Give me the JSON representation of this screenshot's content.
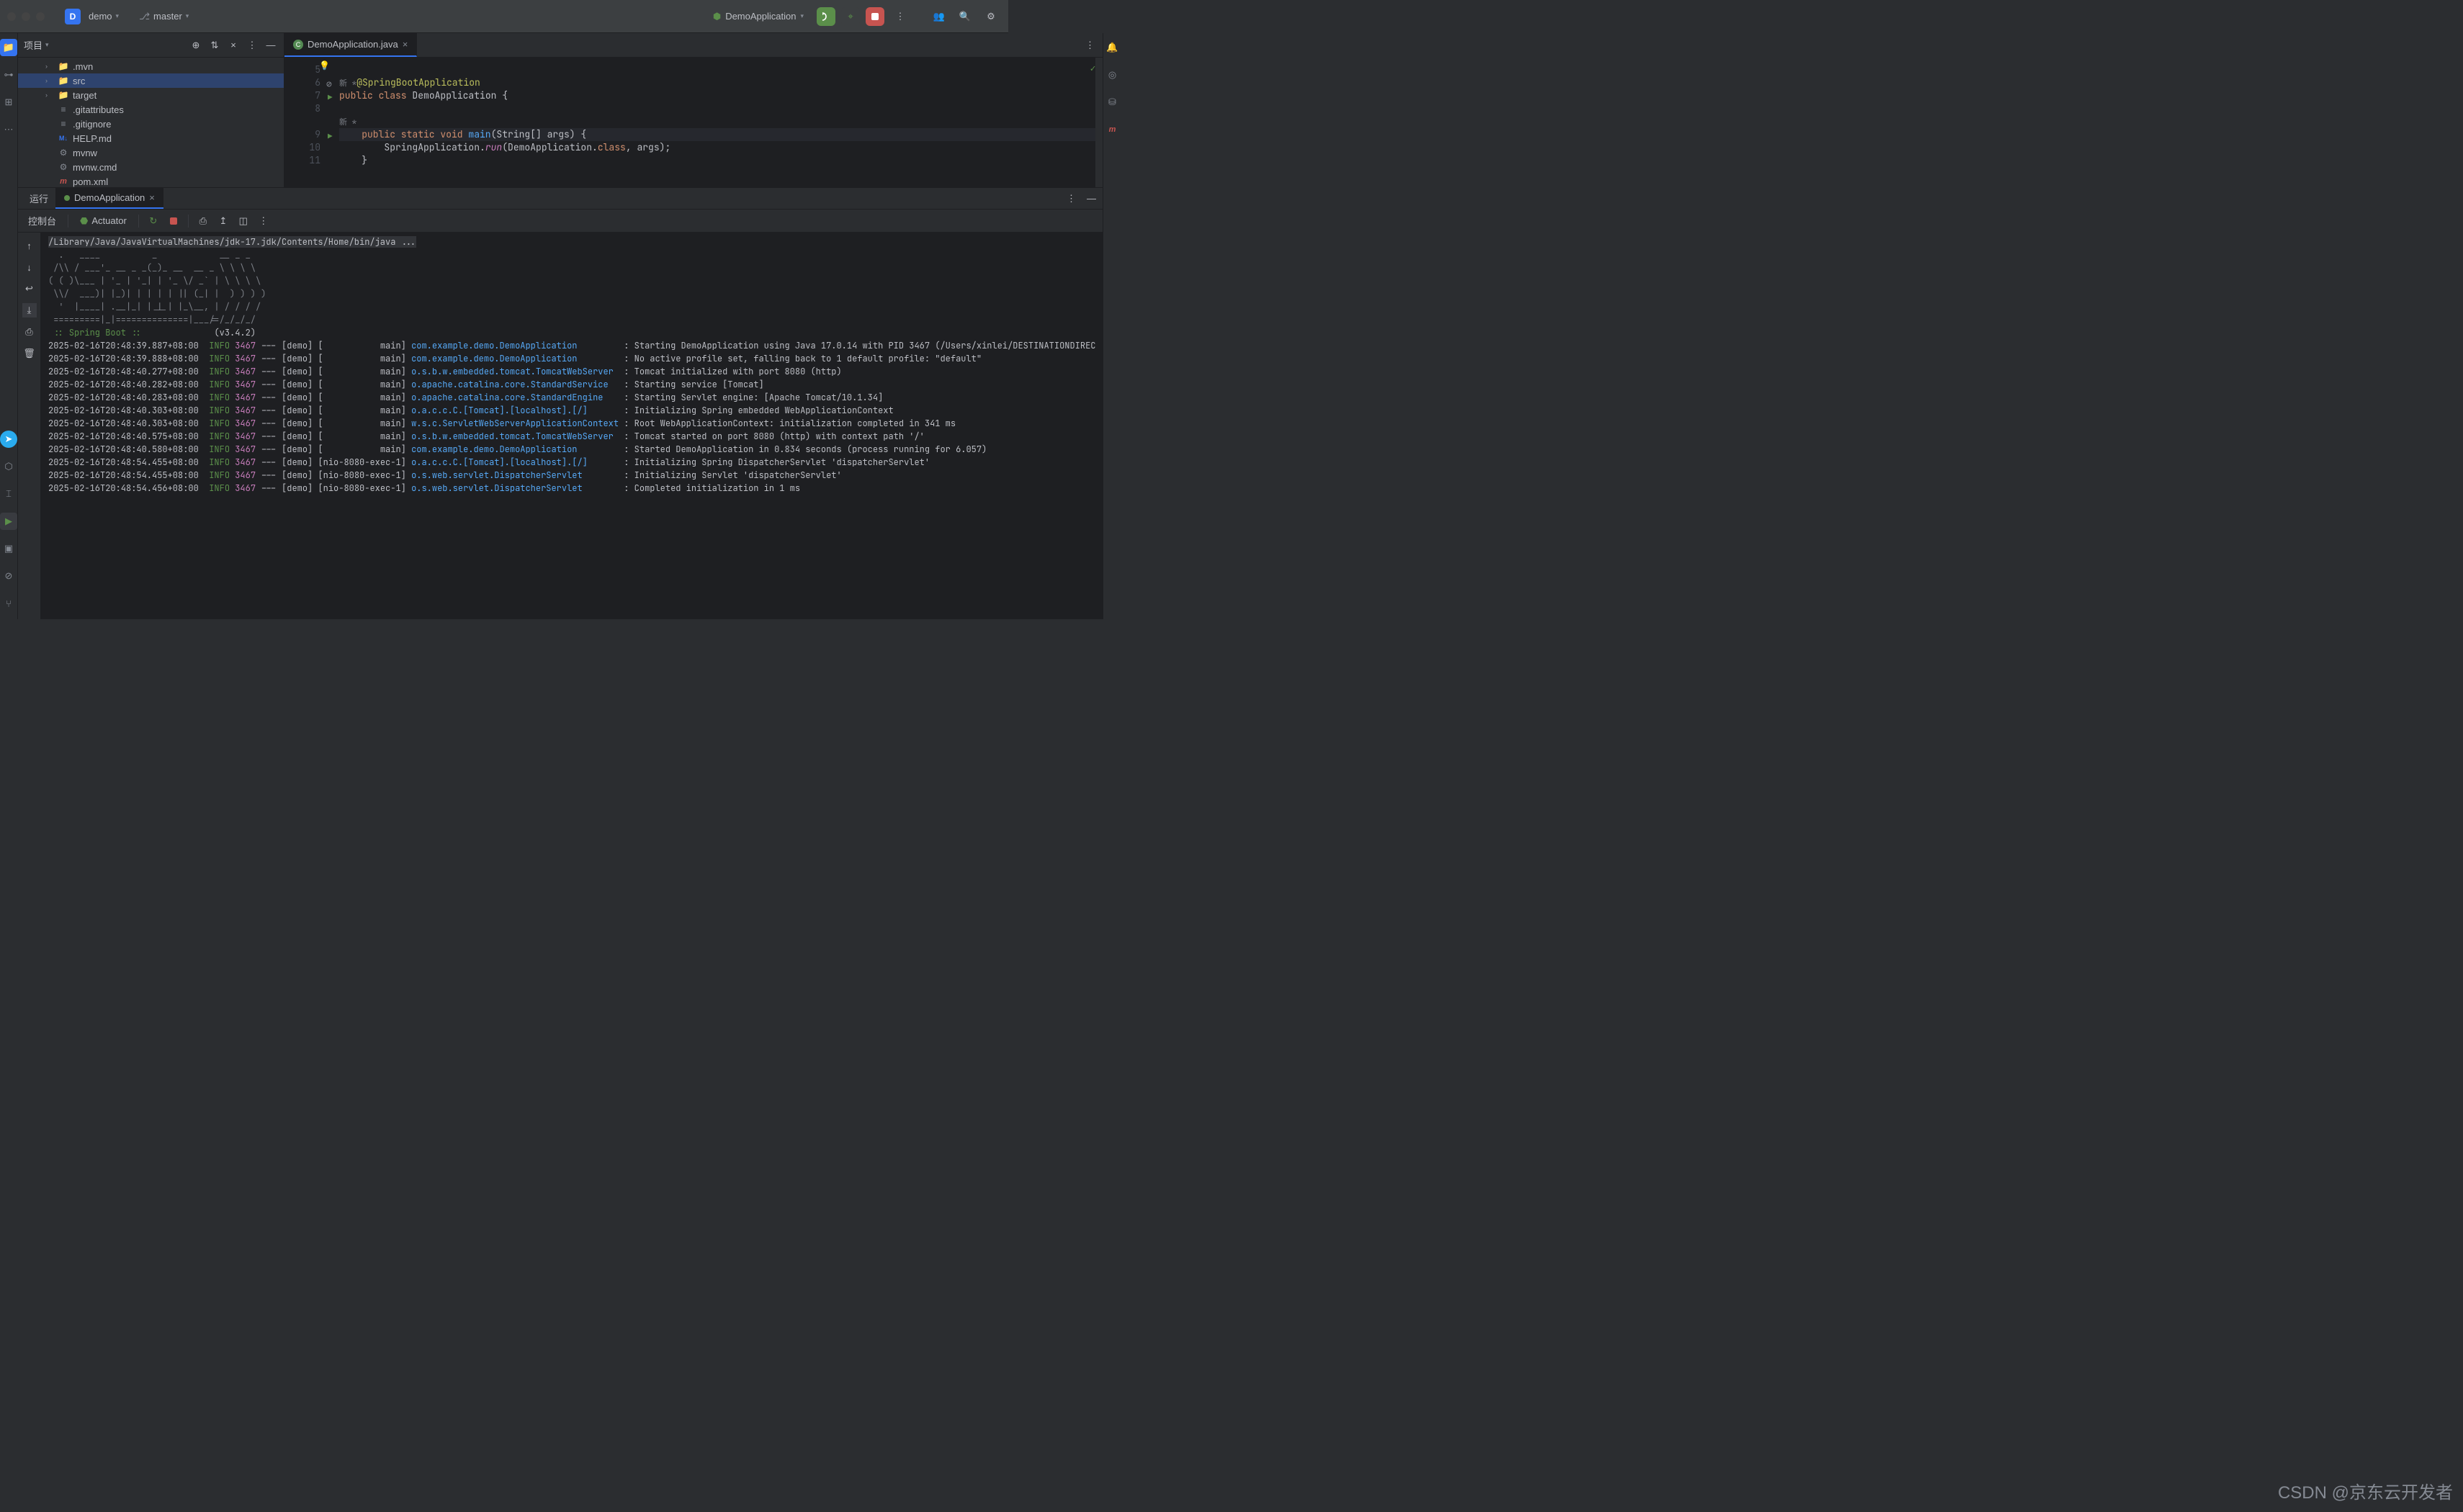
{
  "titlebar": {
    "project_letter": "D",
    "project_name": "demo",
    "branch_name": "master",
    "run_config": "DemoApplication"
  },
  "project": {
    "panel_title": "项目",
    "tree": [
      {
        "name": ".mvn",
        "type": "folder",
        "icon": "folder",
        "indent": 1,
        "expandable": true
      },
      {
        "name": "src",
        "type": "folder",
        "icon": "folder-src",
        "indent": 1,
        "expandable": true,
        "selected": true
      },
      {
        "name": "target",
        "type": "folder",
        "icon": "folder-tgt",
        "indent": 1,
        "expandable": true
      },
      {
        "name": ".gitattributes",
        "type": "file",
        "icon": "file-lines",
        "indent": 1
      },
      {
        "name": ".gitignore",
        "type": "file",
        "icon": "file-lines",
        "indent": 1
      },
      {
        "name": "HELP.md",
        "type": "file",
        "icon": "md",
        "indent": 1
      },
      {
        "name": "mvnw",
        "type": "file",
        "icon": "file-gear",
        "indent": 1
      },
      {
        "name": "mvnw.cmd",
        "type": "file",
        "icon": "file-gear",
        "indent": 1
      },
      {
        "name": "pom.xml",
        "type": "file",
        "icon": "m",
        "indent": 1
      }
    ]
  },
  "editor": {
    "tab_name": "DemoApplication.java",
    "lines": [
      {
        "num": "5",
        "inlay": ""
      },
      {
        "num": "6",
        "inlay": "新 *",
        "annotation": "@SpringBootApplication",
        "gutter": "no-inspect"
      },
      {
        "num": "7",
        "code_parts": [
          "public ",
          "class ",
          "DemoApplication {"
        ],
        "gutter": "run"
      },
      {
        "num": "8"
      },
      {
        "num": "",
        "inlay": "新 *",
        "bulb": true
      },
      {
        "num": "9",
        "gutter": "run",
        "hl": true,
        "code_main": true
      },
      {
        "num": "10",
        "code_spring": true
      },
      {
        "num": "11",
        "brace": "    }"
      }
    ],
    "code9": {
      "pre": "    public static void ",
      "main": "main",
      "args": "(String[] args)",
      "brace": " {"
    },
    "code10": {
      "indent": "        ",
      "app": "SpringApplication.",
      "run": "run",
      "open": "(DemoApplication.",
      "cls": "class",
      "rest": ", args);"
    }
  },
  "run": {
    "run_label": "运行",
    "config_name": "DemoApplication",
    "console_tab": "控制台",
    "actuator_tab": "Actuator",
    "cmd_line": "/Library/Java/JavaVirtualMachines/jdk-17.jdk/Contents/Home/bin/java ...",
    "banner": [
      "  .   ____          _            __ _ _",
      " /\\\\ / ___'_ __ _ _(_)_ __  __ _ \\ \\ \\ \\",
      "( ( )\\___ | '_ | '_| | '_ \\/ _` | \\ \\ \\ \\",
      " \\\\/  ___)| |_)| | | | | || (_| |  ) ) ) )",
      "  '  |____| .__|_| |_|_| |_\\__, | / / / /",
      " =========|_|==============|___/=/_/_/_/"
    ],
    "boot_label": " :: Spring Boot :: ",
    "boot_version": "(v3.4.2)",
    "logs": [
      {
        "ts": "2025-02-16T20:48:39.887+08:00",
        "lvl": "INFO",
        "pid": "3467",
        "thread": "--- [demo] [           main] ",
        "logger": "com.example.demo.DemoApplication        ",
        "msg": " : Starting DemoApplication using Java 17.0.14 with PID 3467 (/Users/xinlei/DESTINATIONDIREC"
      },
      {
        "ts": "2025-02-16T20:48:39.888+08:00",
        "lvl": "INFO",
        "pid": "3467",
        "thread": "--- [demo] [           main] ",
        "logger": "com.example.demo.DemoApplication        ",
        "msg": " : No active profile set, falling back to 1 default profile: \"default\""
      },
      {
        "ts": "2025-02-16T20:48:40.277+08:00",
        "lvl": "INFO",
        "pid": "3467",
        "thread": "--- [demo] [           main] ",
        "logger": "o.s.b.w.embedded.tomcat.TomcatWebServer ",
        "msg": " : Tomcat initialized with port 8080 (http)"
      },
      {
        "ts": "2025-02-16T20:48:40.282+08:00",
        "lvl": "INFO",
        "pid": "3467",
        "thread": "--- [demo] [           main] ",
        "logger": "o.apache.catalina.core.StandardService  ",
        "msg": " : Starting service [Tomcat]"
      },
      {
        "ts": "2025-02-16T20:48:40.283+08:00",
        "lvl": "INFO",
        "pid": "3467",
        "thread": "--- [demo] [           main] ",
        "logger": "o.apache.catalina.core.StandardEngine   ",
        "msg": " : Starting Servlet engine: [Apache Tomcat/10.1.34]"
      },
      {
        "ts": "2025-02-16T20:48:40.303+08:00",
        "lvl": "INFO",
        "pid": "3467",
        "thread": "--- [demo] [           main] ",
        "logger": "o.a.c.c.C.[Tomcat].[localhost].[/]      ",
        "msg": " : Initializing Spring embedded WebApplicationContext"
      },
      {
        "ts": "2025-02-16T20:48:40.303+08:00",
        "lvl": "INFO",
        "pid": "3467",
        "thread": "--- [demo] [           main] ",
        "logger": "w.s.c.ServletWebServerApplicationContext",
        "msg": " : Root WebApplicationContext: initialization completed in 341 ms"
      },
      {
        "ts": "2025-02-16T20:48:40.575+08:00",
        "lvl": "INFO",
        "pid": "3467",
        "thread": "--- [demo] [           main] ",
        "logger": "o.s.b.w.embedded.tomcat.TomcatWebServer ",
        "msg": " : Tomcat started on port 8080 (http) with context path '/'"
      },
      {
        "ts": "2025-02-16T20:48:40.580+08:00",
        "lvl": "INFO",
        "pid": "3467",
        "thread": "--- [demo] [           main] ",
        "logger": "com.example.demo.DemoApplication        ",
        "msg": " : Started DemoApplication in 0.834 seconds (process running for 6.057)"
      },
      {
        "ts": "2025-02-16T20:48:54.455+08:00",
        "lvl": "INFO",
        "pid": "3467",
        "thread": "--- [demo] [nio-8080-exec-1] ",
        "logger": "o.a.c.c.C.[Tomcat].[localhost].[/]      ",
        "msg": " : Initializing Spring DispatcherServlet 'dispatcherServlet'"
      },
      {
        "ts": "2025-02-16T20:48:54.455+08:00",
        "lvl": "INFO",
        "pid": "3467",
        "thread": "--- [demo] [nio-8080-exec-1] ",
        "logger": "o.s.web.servlet.DispatcherServlet       ",
        "msg": " : Initializing Servlet 'dispatcherServlet'"
      },
      {
        "ts": "2025-02-16T20:48:54.456+08:00",
        "lvl": "INFO",
        "pid": "3467",
        "thread": "--- [demo] [nio-8080-exec-1] ",
        "logger": "o.s.web.servlet.DispatcherServlet       ",
        "msg": " : Completed initialization in 1 ms"
      }
    ]
  },
  "watermark": "CSDN @京东云开发者"
}
